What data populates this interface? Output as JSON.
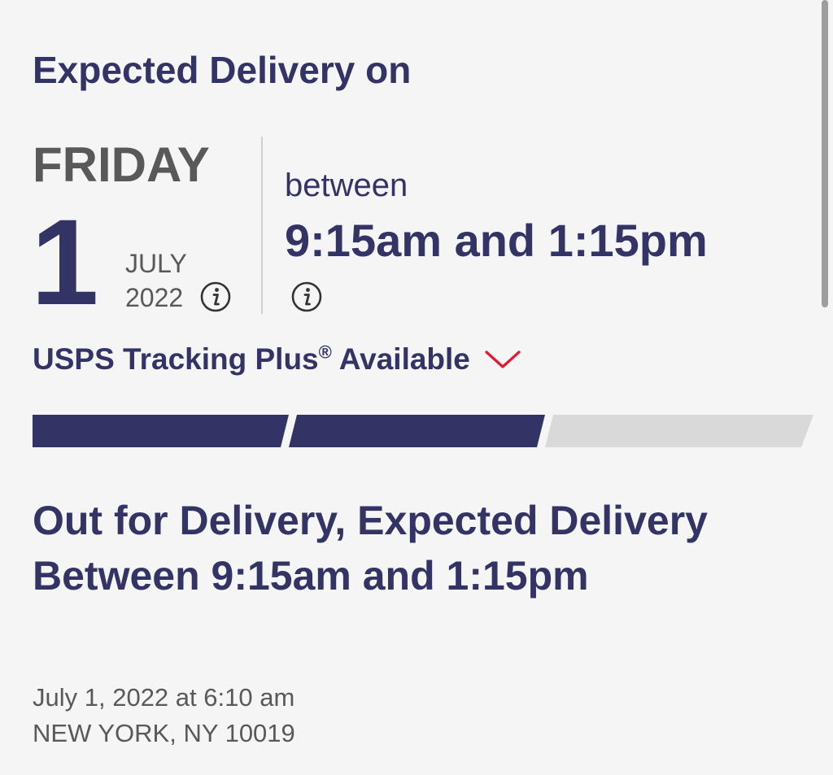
{
  "header": {
    "title": "Expected Delivery on"
  },
  "delivery": {
    "day_name": "FRIDAY",
    "day_number": "1",
    "month": "JULY",
    "year": "2022",
    "between_label": "between",
    "time_window": "9:15am and 1:15pm",
    "info_icon": "info-icon"
  },
  "tracking_plus": {
    "label": "USPS Tracking Plus",
    "registered_mark": "®",
    "suffix": "Available",
    "expand_icon": "chevron-down-icon",
    "accent_color": "#e31837"
  },
  "progress": {
    "segments_total": 3,
    "segments_completed": 2,
    "complete_color": "#333366",
    "incomplete_color": "#d9d9d9"
  },
  "status": {
    "headline": "Out for Delivery, Expected Delivery Between 9:15am and 1:15pm",
    "date": "July 1, 2022 at 6:10 am",
    "location": "NEW YORK, NY 10019"
  },
  "colors": {
    "brand_navy": "#333366",
    "text_gray": "#595959",
    "background": "#f5f5f5"
  }
}
